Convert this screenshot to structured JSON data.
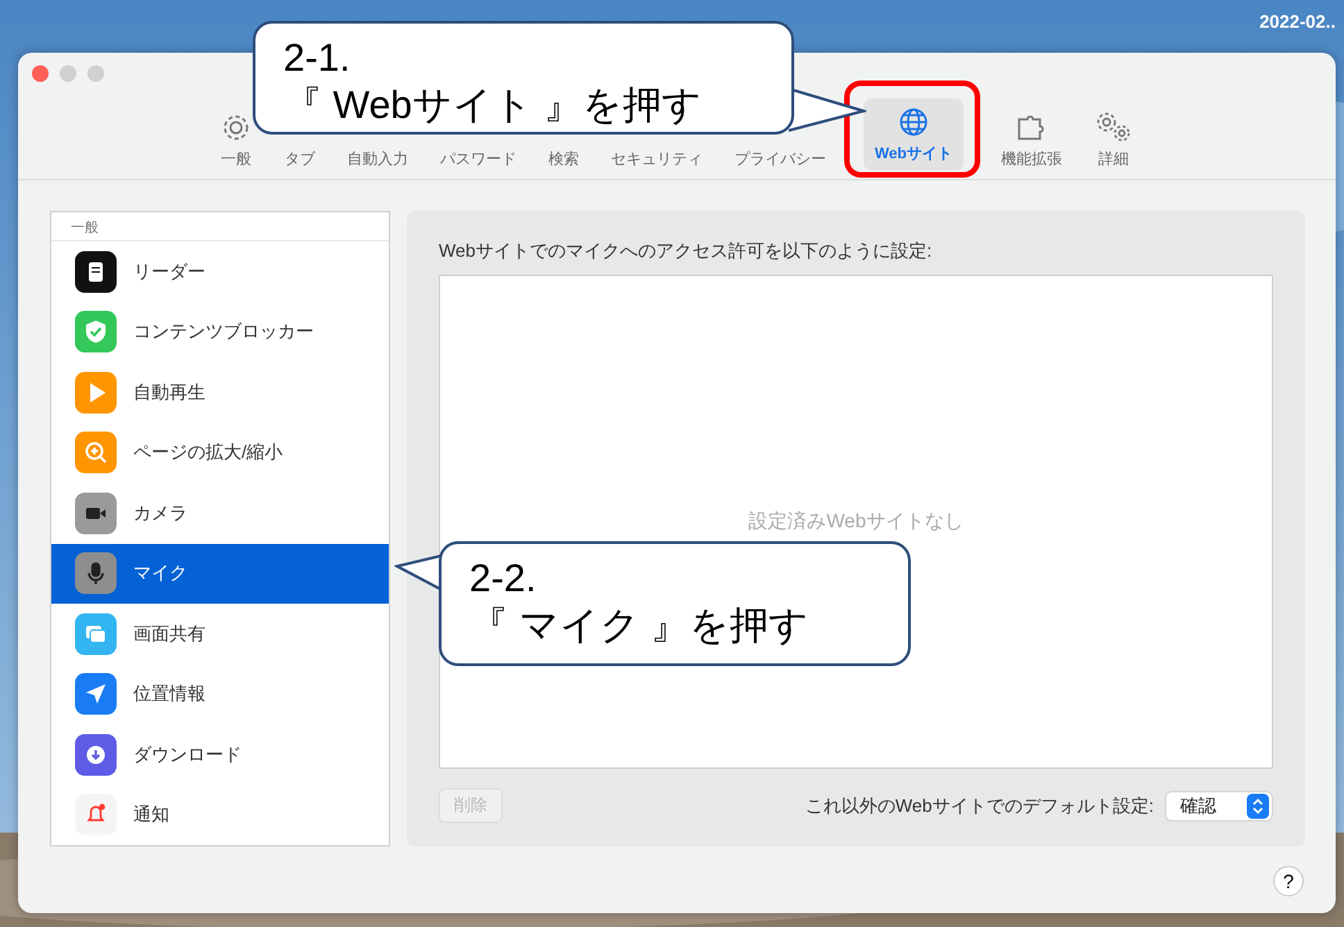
{
  "desktop": {
    "date": "2022-02.."
  },
  "toolbar": [
    {
      "label": "一般",
      "kind": "gear",
      "selected": false
    },
    {
      "label": "タブ",
      "kind": "none",
      "selected": false
    },
    {
      "label": "自動入力",
      "kind": "none",
      "selected": false
    },
    {
      "label": "パスワード",
      "kind": "none",
      "selected": false
    },
    {
      "label": "検索",
      "kind": "none",
      "selected": false
    },
    {
      "label": "セキュリティ",
      "kind": "none",
      "selected": false
    },
    {
      "label": "プライバシー",
      "kind": "none",
      "selected": false
    },
    {
      "label": "Webサイト",
      "kind": "globe",
      "selected": true
    },
    {
      "label": "機能拡張",
      "kind": "puzzle",
      "selected": false
    },
    {
      "label": "詳細",
      "kind": "gears",
      "selected": false
    }
  ],
  "sidebar": {
    "heading": "一般",
    "items": [
      {
        "label": "リーダー",
        "kind": "reader",
        "selected": false
      },
      {
        "label": "コンテンツブロッカー",
        "kind": "shield",
        "selected": false
      },
      {
        "label": "自動再生",
        "kind": "play",
        "selected": false
      },
      {
        "label": "ページの拡大/縮小",
        "kind": "zoom",
        "selected": false
      },
      {
        "label": "カメラ",
        "kind": "camera",
        "selected": false
      },
      {
        "label": "マイク",
        "kind": "mic",
        "selected": true
      },
      {
        "label": "画面共有",
        "kind": "screen",
        "selected": false
      },
      {
        "label": "位置情報",
        "kind": "location",
        "selected": false
      },
      {
        "label": "ダウンロード",
        "kind": "download",
        "selected": false
      },
      {
        "label": "通知",
        "kind": "bell",
        "selected": false
      }
    ]
  },
  "panel": {
    "description": "Webサイトでのマイクへのアクセス許可を以下のように設定:",
    "empty_text": "設定済みWebサイトなし",
    "delete_button": {
      "label": "削除",
      "disabled": true
    },
    "default_label": "これ以外のWebサイトでのデフォルト設定:",
    "default_value": "確認"
  },
  "help_button": "?",
  "callouts": [
    {
      "step": "2-1.",
      "text": "『 Webサイト 』を押す"
    },
    {
      "step": "2-2.",
      "text": "『 マイク 』を押す"
    }
  ]
}
